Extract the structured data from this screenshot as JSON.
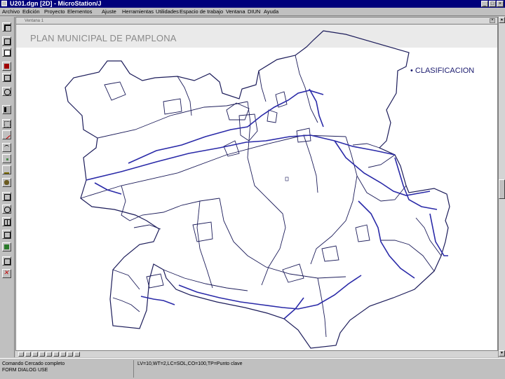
{
  "window": {
    "title": "U201.dgn [2D] - MicroStation/J"
  },
  "menu": {
    "items": [
      "Archivo",
      "Edición",
      "Proyecto",
      "Elementos",
      "Ajuste",
      "Herramientas",
      "Utilidades",
      "Espacio de trabajo",
      "Ventana",
      "DIUN",
      "Ayuda"
    ]
  },
  "view": {
    "title": "Ventana 1",
    "heading": "PLAN MUNICIPAL DE PAMPLONA",
    "legend_label": "• CLASIFICACION",
    "colors": {
      "boundary": "#1c1c5a",
      "roads": "#2a2aa8"
    }
  },
  "icons": {
    "toolbox": [
      "element-selection-icon",
      "fence-icon",
      "line-icon",
      "arc-icon",
      "point-icon",
      "text-icon",
      "cell-icon",
      "zoom-icon",
      "view-icon",
      "measure-icon",
      "delete-icon"
    ]
  },
  "status": {
    "left_line1": "Comando Cercado completo",
    "left_line2": "FORM DIALOG USE",
    "right_line1": "LV=10,WT=2,LC=SOL,CO=100,TP=Punto clave"
  }
}
